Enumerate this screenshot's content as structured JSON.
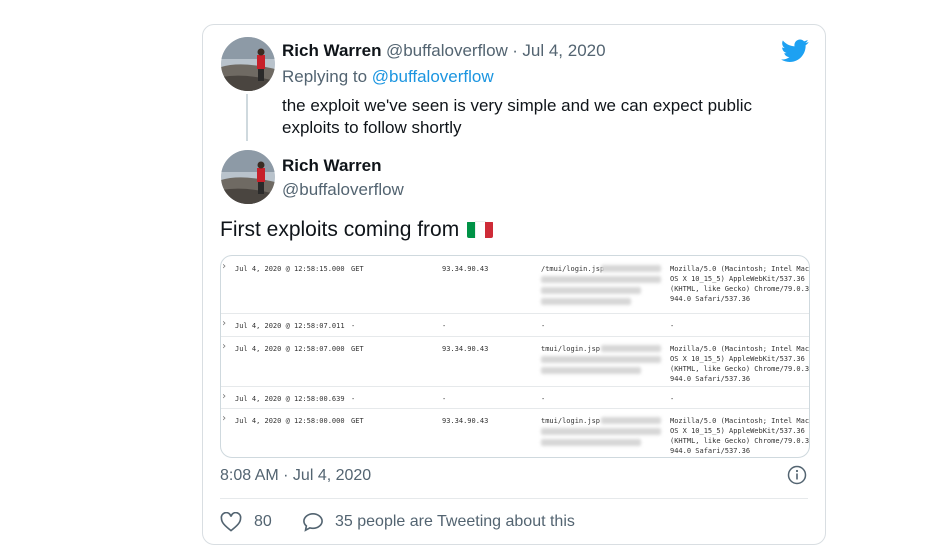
{
  "parent_tweet": {
    "author_name": "Rich Warren",
    "author_handle": "@buffaloverflow",
    "separator": "·",
    "date": "Jul 4, 2020",
    "replying_prefix": "Replying to",
    "replying_handle": "@buffaloverflow",
    "text_line1": "the exploit we've seen is very simple and we can expect public",
    "text_line2": "exploits to follow shortly"
  },
  "main_tweet": {
    "author_name": "Rich Warren",
    "author_handle": "@buffaloverflow",
    "text": "First exploits coming from",
    "flag_colors": [
      "#009246",
      "#ffffff",
      "#ce2b37"
    ],
    "timestamp": "8:08 AM · Jul 4, 2020",
    "likes": "80",
    "retweet_text": "35 people are Tweeting about this"
  },
  "log_rows": [
    {
      "arrow": "›",
      "time": "Jul 4, 2020 @ 12:58:15.000",
      "method": "GET",
      "ip": "93.34.90.43",
      "path": "/tmui/login.jsp",
      "ua": "Mozilla/5.0 (Macintosh; Intel Mac\nOS X 10_15_5) AppleWebKit/537.36\n(KHTML, like Gecko) Chrome/79.0.3\n944.0 Safari/537.36"
    },
    {
      "arrow": "›",
      "time": "Jul 4, 2020 @ 12:58:07.011",
      "method": "-",
      "ip": "-",
      "path": "-",
      "ua": "-"
    },
    {
      "arrow": "›",
      "time": "Jul 4, 2020 @ 12:58:07.000",
      "method": "GET",
      "ip": "93.34.90.43",
      "path": "tmui/login.jsp",
      "ua": "Mozilla/5.0 (Macintosh; Intel Mac\nOS X 10_15_5) AppleWebKit/537.36\n(KHTML, like Gecko) Chrome/79.0.3\n944.0 Safari/537.36"
    },
    {
      "arrow": "›",
      "time": "Jul 4, 2020 @ 12:58:00.639",
      "method": "-",
      "ip": "-",
      "path": "-",
      "ua": "-"
    },
    {
      "arrow": "›",
      "time": "Jul 4, 2020 @ 12:58:00.000",
      "method": "GET",
      "ip": "93.34.90.43",
      "path": "tmui/login.jsp",
      "ua": "Mozilla/5.0 (Macintosh; Intel Mac\nOS X 10_15_5) AppleWebKit/537.36\n(KHTML, like Gecko) Chrome/79.0.3\n944.0 Safari/537.36"
    }
  ],
  "icons": {
    "brand": "twitter-bird-icon",
    "info": "info-icon",
    "like": "heart-icon",
    "reply": "speech-bubble-icon"
  },
  "colors": {
    "brand": "#1da1f2",
    "link": "#1b95e0",
    "muted": "#536471"
  }
}
